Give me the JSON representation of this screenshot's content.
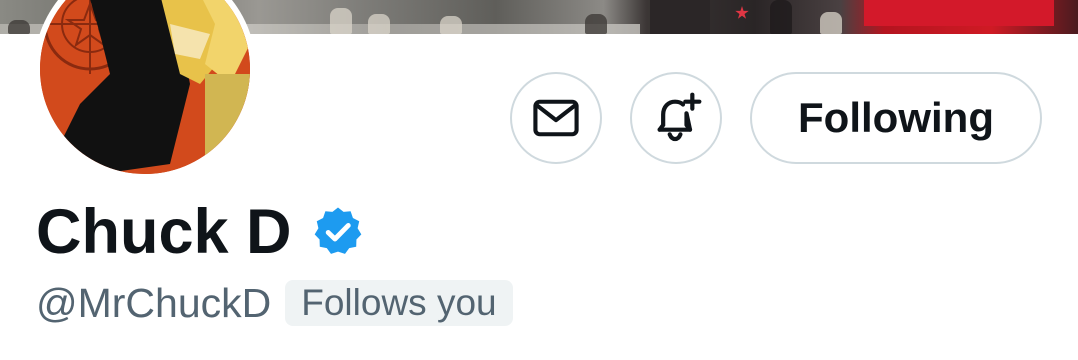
{
  "profile": {
    "display_name": "Chuck D",
    "handle": "@MrChuckD",
    "follows_you_label": "Follows you",
    "verified": true
  },
  "actions": {
    "message_icon": "envelope-icon",
    "notify_icon": "bell-plus-icon",
    "following_label": "Following"
  },
  "colors": {
    "text_primary": "#0f1419",
    "text_secondary": "#536471",
    "verified_blue": "#1d9bf0",
    "button_border": "#cfd9de",
    "badge_bg": "#eff3f4"
  }
}
